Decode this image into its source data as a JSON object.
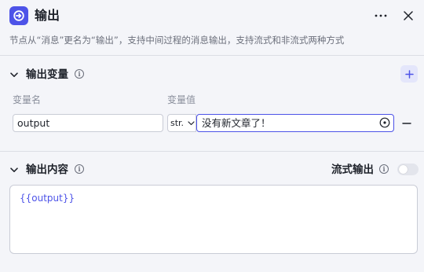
{
  "header": {
    "title": "输出",
    "description": "节点从“消息”更名为“输出”，支持中间过程的消息输出，支持流式和非流式两种方式",
    "more_label": "···"
  },
  "output_variables": {
    "section_title": "输出变量",
    "info_label": "i",
    "columns": {
      "name": "变量名",
      "value": "变量值"
    },
    "rows": [
      {
        "name": "output",
        "type": "str.",
        "value": "没有新文章了！"
      }
    ]
  },
  "output_content": {
    "section_title": "输出内容",
    "info_label": "i",
    "streaming_label": "流式输出",
    "streaming_enabled": false,
    "content": "{{output}}"
  },
  "colors": {
    "accent": "#4d53e8",
    "background": "#f4f5f9",
    "divider": "#dcdee5"
  },
  "icons": {
    "node": "output-node-icon",
    "more": "more-icon",
    "close": "close-icon",
    "collapse": "chevron-down-icon",
    "info": "info-icon",
    "add": "plus-icon",
    "remove": "minus-icon",
    "reference": "reference-icon"
  }
}
